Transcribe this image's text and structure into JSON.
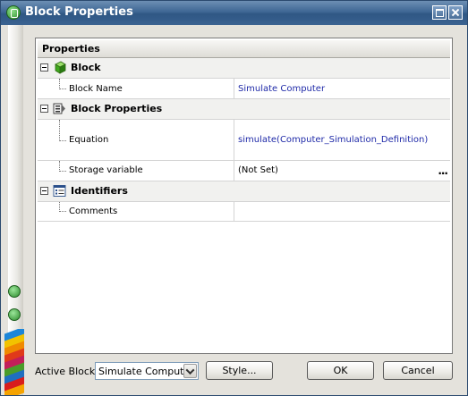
{
  "window": {
    "title": "Block Properties"
  },
  "grid": {
    "header": "Properties",
    "categories": [
      {
        "label": "Block",
        "icon": "green-cube-icon",
        "properties": [
          {
            "name": "Block Name",
            "value": "Simulate Computer"
          }
        ]
      },
      {
        "label": "Block Properties",
        "icon": "block-properties-icon",
        "properties": [
          {
            "name": "Equation",
            "value": "simulate(Computer_Simulation_Definition)"
          },
          {
            "name": "Storage variable",
            "value": "(Not Set)",
            "button": "..."
          }
        ]
      },
      {
        "label": "Identifiers",
        "icon": "identifiers-icon",
        "properties": [
          {
            "name": "Comments",
            "value": ""
          }
        ]
      }
    ]
  },
  "footer": {
    "active_block_label": "Active Block",
    "active_block_value": "Simulate Computer",
    "style_button": "Style...",
    "ok_button": "OK",
    "cancel_button": "Cancel"
  },
  "colors": {
    "title_bar": "#3f6794",
    "value_text": "#1f2aa8",
    "category_bg": "#f1f1ef"
  }
}
